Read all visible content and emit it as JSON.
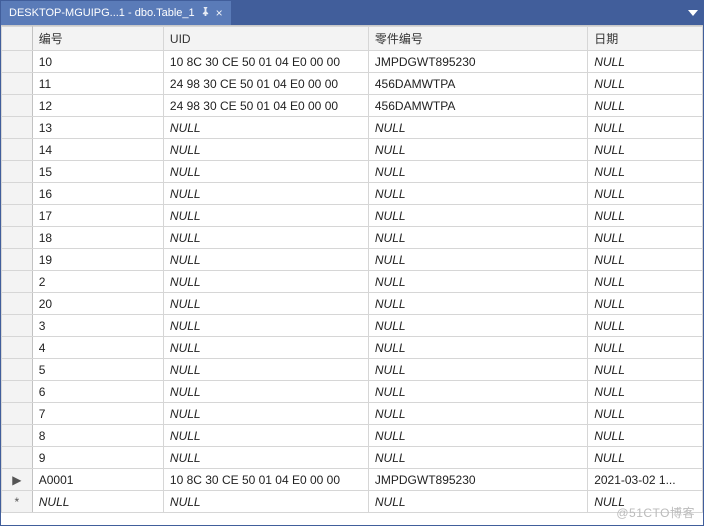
{
  "tab": {
    "title": "DESKTOP-MGUIPG...1 - dbo.Table_1",
    "pin_icon": "⁠⁠⁠⁠⁠⁠⁠⁠",
    "close_icon": "×"
  },
  "null_label": "NULL",
  "columns": {
    "id": "编号",
    "uid": "UID",
    "part": "零件编号",
    "date": "日期"
  },
  "row_selector_current": "▶",
  "row_selector_new": "*",
  "watermark": "@51CTO博客",
  "rows": [
    {
      "sel": "",
      "id": "10",
      "uid": "10 8C 30 CE 50 01 04 E0 00 00",
      "part": "JMPDGWT895230",
      "date": null
    },
    {
      "sel": "",
      "id": "11",
      "uid": "24 98 30 CE 50 01 04 E0 00 00",
      "part": "456DAMWTPA",
      "date": null
    },
    {
      "sel": "",
      "id": "12",
      "uid": "24 98 30 CE 50 01 04 E0 00 00",
      "part": "456DAMWTPA",
      "date": null
    },
    {
      "sel": "",
      "id": "13",
      "uid": null,
      "part": null,
      "date": null
    },
    {
      "sel": "",
      "id": "14",
      "uid": null,
      "part": null,
      "date": null
    },
    {
      "sel": "",
      "id": "15",
      "uid": null,
      "part": null,
      "date": null
    },
    {
      "sel": "",
      "id": "16",
      "uid": null,
      "part": null,
      "date": null
    },
    {
      "sel": "",
      "id": "17",
      "uid": null,
      "part": null,
      "date": null
    },
    {
      "sel": "",
      "id": "18",
      "uid": null,
      "part": null,
      "date": null
    },
    {
      "sel": "",
      "id": "19",
      "uid": null,
      "part": null,
      "date": null
    },
    {
      "sel": "",
      "id": "2",
      "uid": null,
      "part": null,
      "date": null
    },
    {
      "sel": "",
      "id": "20",
      "uid": null,
      "part": null,
      "date": null
    },
    {
      "sel": "",
      "id": "3",
      "uid": null,
      "part": null,
      "date": null
    },
    {
      "sel": "",
      "id": "4",
      "uid": null,
      "part": null,
      "date": null
    },
    {
      "sel": "",
      "id": "5",
      "uid": null,
      "part": null,
      "date": null
    },
    {
      "sel": "",
      "id": "6",
      "uid": null,
      "part": null,
      "date": null
    },
    {
      "sel": "",
      "id": "7",
      "uid": null,
      "part": null,
      "date": null
    },
    {
      "sel": "",
      "id": "8",
      "uid": null,
      "part": null,
      "date": null
    },
    {
      "sel": "",
      "id": "9",
      "uid": null,
      "part": null,
      "date": null
    },
    {
      "sel": "current",
      "id": "A0001",
      "uid": "10 8C 30 CE 50 01 04 E0 00 00",
      "part": "JMPDGWT895230",
      "date": "2021-03-02 1..."
    },
    {
      "sel": "new",
      "id": null,
      "uid": null,
      "part": null,
      "date": null
    }
  ]
}
